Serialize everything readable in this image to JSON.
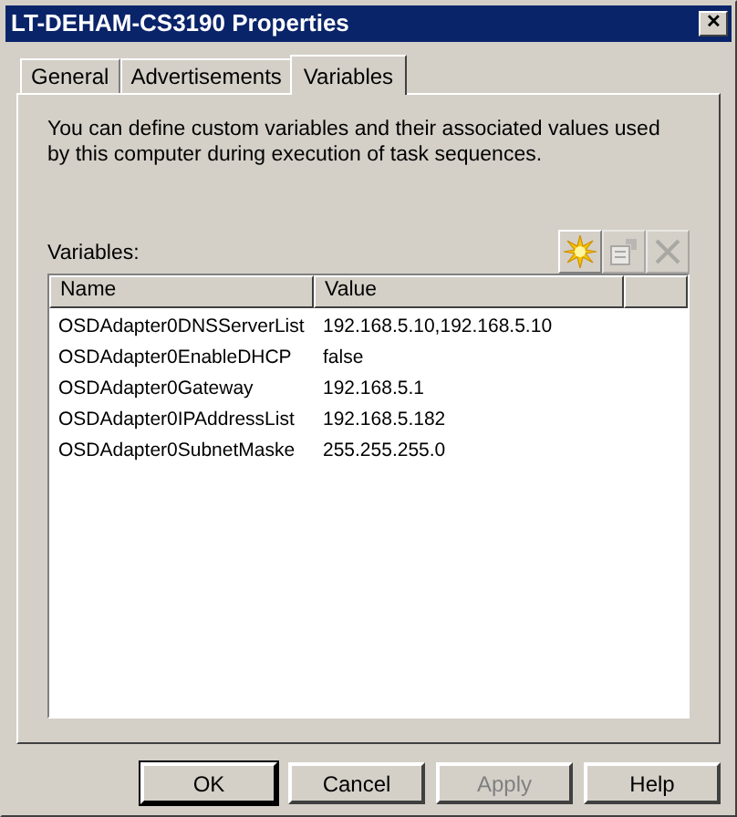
{
  "window": {
    "title": "LT-DEHAM-CS3190 Properties",
    "close": "✕"
  },
  "tabs": [
    {
      "label": "General",
      "selected": false
    },
    {
      "label": "Advertisements",
      "selected": false
    },
    {
      "label": "Variables",
      "selected": true
    }
  ],
  "description": "You can define custom variables and their associated values used by this computer during execution of task sequences.",
  "variables_label": "Variables:",
  "toolbar": [
    {
      "kind": "new",
      "disabled": false
    },
    {
      "kind": "properties",
      "disabled": true
    },
    {
      "kind": "delete",
      "disabled": true
    }
  ],
  "table": {
    "columns": [
      "Name",
      "Value"
    ],
    "rows": [
      [
        "OSDAdapter0DNSServerList",
        "192.168.5.10,192.168.5.10"
      ],
      [
        "OSDAdapter0EnableDHCP",
        "false"
      ],
      [
        "OSDAdapter0Gateway",
        "192.168.5.1"
      ],
      [
        "OSDAdapter0IPAddressList",
        "192.168.5.182"
      ],
      [
        "OSDAdapter0SubnetMaske",
        "255.255.255.0"
      ]
    ]
  },
  "buttons": [
    {
      "label": "OK",
      "default": true,
      "disabled": false
    },
    {
      "label": "Cancel",
      "default": false,
      "disabled": false
    },
    {
      "label": "Apply",
      "default": false,
      "disabled": true
    },
    {
      "label": "Help",
      "default": false,
      "disabled": false
    }
  ]
}
